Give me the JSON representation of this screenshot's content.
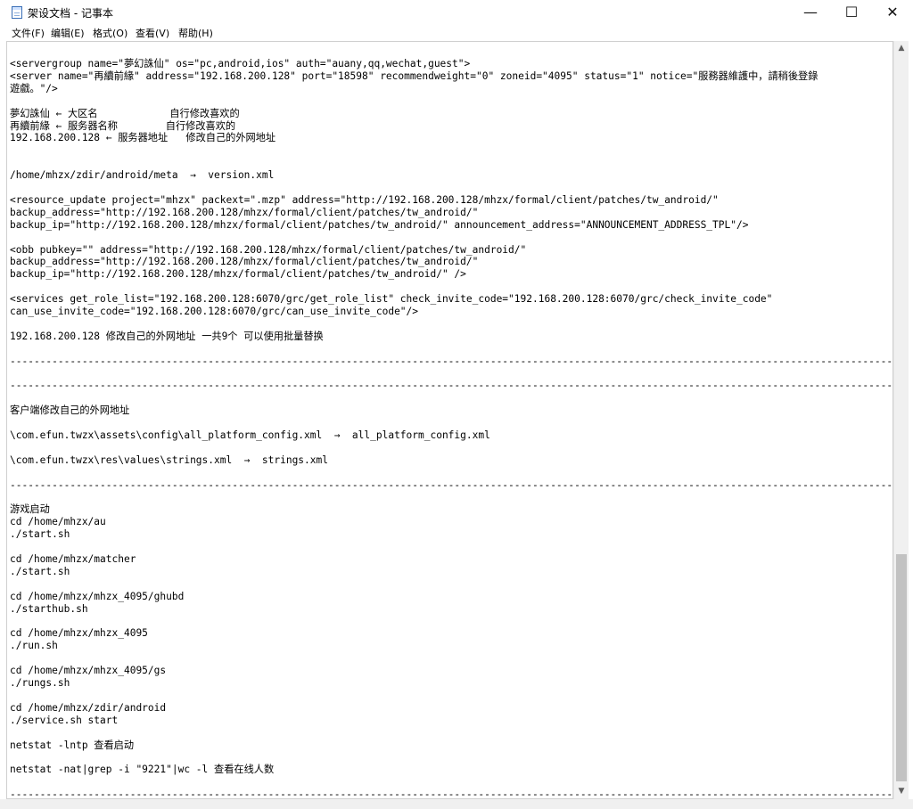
{
  "window": {
    "title": "架设文档 - 记事本",
    "minimize_glyph": "—",
    "maximize_glyph": "☐",
    "close_glyph": "✕"
  },
  "menu": [
    "文件(F)",
    "编辑(E)",
    "格式(O)",
    "查看(V)",
    "帮助(H)"
  ],
  "editor": {
    "lines": [
      "<servergroup name=\"夢幻誅仙\" os=\"pc,android,ios\" auth=\"auany,qq,wechat,guest\">",
      "<server name=\"再續前緣\" address=\"192.168.200.128\" port=\"18598\" recommendweight=\"0\" zoneid=\"4095\" status=\"1\" notice=\"服務器維護中，請稍後登錄",
      "遊戲。\"/>",
      "",
      "夢幻誅仙 ← 大区名            自行修改喜欢的",
      "再續前緣 ← 服务器名称        自行修改喜欢的",
      "192.168.200.128 ← 服务器地址   修改自己的外网地址",
      "",
      "",
      "/home/mhzx/zdir/android/meta  →  version.xml",
      "",
      "<resource_update project=\"mhzx\" packext=\".mzp\" address=\"http://192.168.200.128/mhzx/formal/client/patches/tw_android/\"",
      "backup_address=\"http://192.168.200.128/mhzx/formal/client/patches/tw_android/\"",
      "backup_ip=\"http://192.168.200.128/mhzx/formal/client/patches/tw_android/\" announcement_address=\"ANNOUNCEMENT_ADDRESS_TPL\"/>",
      "",
      "<obb pubkey=\"\" address=\"http://192.168.200.128/mhzx/formal/client/patches/tw_android/\"",
      "backup_address=\"http://192.168.200.128/mhzx/formal/client/patches/tw_android/\"",
      "backup_ip=\"http://192.168.200.128/mhzx/formal/client/patches/tw_android/\" />",
      "",
      "<services get_role_list=\"192.168.200.128:6070/grc/get_role_list\" check_invite_code=\"192.168.200.128:6070/grc/check_invite_code\"",
      "can_use_invite_code=\"192.168.200.128:6070/grc/can_use_invite_code\"/>",
      "",
      "192.168.200.128 修改自己的外网地址 一共9个 可以使用批量替换",
      "",
      "------------------------------------------------------------------------------------------------------------------------------------------------------------",
      "",
      "------------------------------------------------------------------------------------------------------------------------------------------------------------",
      "",
      "客户端修改自己的外网地址",
      "",
      "\\com.efun.twzx\\assets\\config\\all_platform_config.xml  →  all_platform_config.xml",
      "",
      "\\com.efun.twzx\\res\\values\\strings.xml  →  strings.xml",
      "",
      "------------------------------------------------------------------------------------------------------------------------------------------------------------",
      "",
      "游戏启动",
      "cd /home/mhzx/au",
      "./start.sh",
      "",
      "cd /home/mhzx/matcher",
      "./start.sh",
      "",
      "cd /home/mhzx/mhzx_4095/ghubd",
      "./starthub.sh",
      "",
      "cd /home/mhzx/mhzx_4095",
      "./run.sh",
      "",
      "cd /home/mhzx/mhzx_4095/gs",
      "./rungs.sh",
      "",
      "cd /home/mhzx/zdir/android",
      "./service.sh start",
      "",
      "netstat -lntp 查看启动",
      "",
      "netstat -nat|grep -i \"9221\"|wc -l 查看在线人数",
      "",
      "------------------------------------------------------------------------------------------------------------------------------------------------------------"
    ]
  },
  "scrollbar": {
    "up_glyph": "▲",
    "down_glyph": "▼"
  }
}
